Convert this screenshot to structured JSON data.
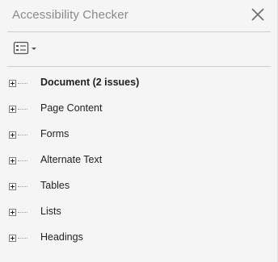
{
  "panel": {
    "title": "Accessibility Checker"
  },
  "toolbar": {
    "options_icon": "options-list-icon"
  },
  "tree": {
    "items": [
      {
        "label": "Document (2 issues)",
        "bold": true
      },
      {
        "label": "Page Content",
        "bold": false
      },
      {
        "label": "Forms",
        "bold": false
      },
      {
        "label": "Alternate Text",
        "bold": false
      },
      {
        "label": "Tables",
        "bold": false
      },
      {
        "label": "Lists",
        "bold": false
      },
      {
        "label": "Headings",
        "bold": false
      }
    ]
  },
  "colors": {
    "background": "#f5f5f5",
    "title_text": "#8a8a8a",
    "divider": "#cfcfcf"
  }
}
